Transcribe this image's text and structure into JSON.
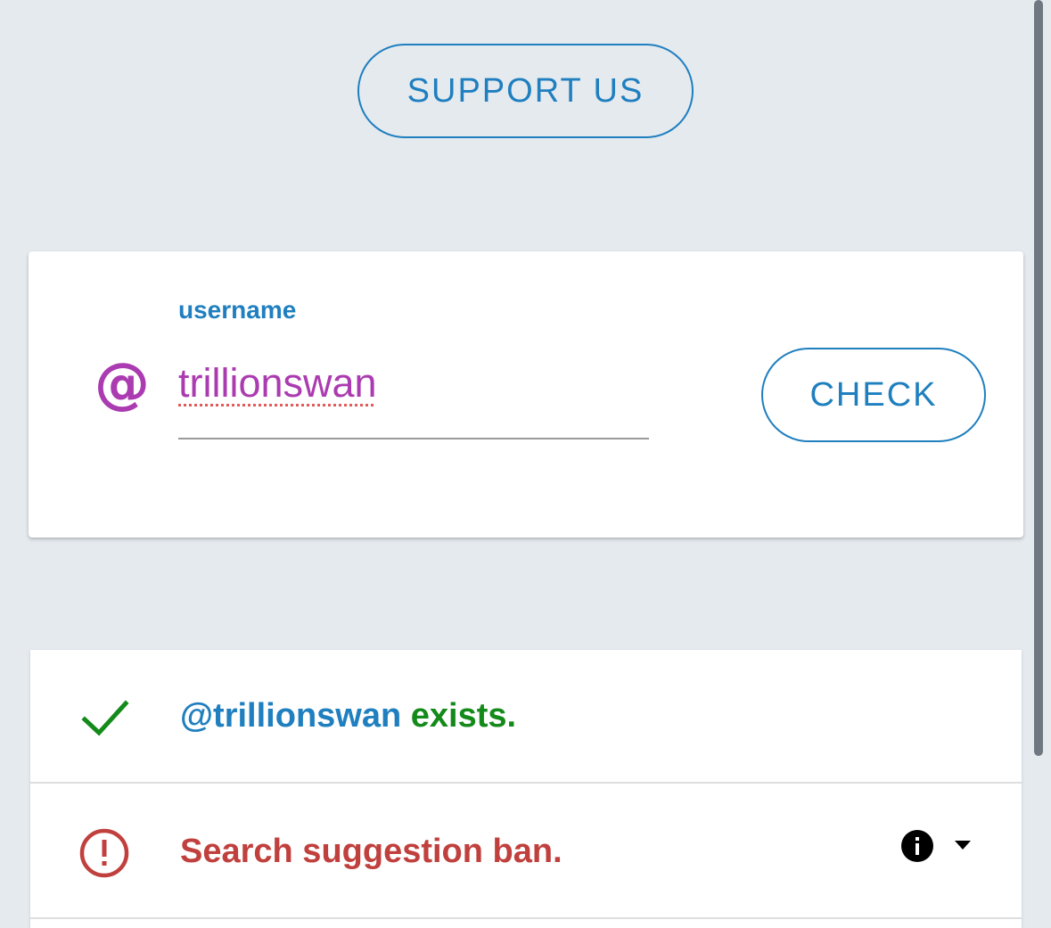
{
  "support": {
    "label": "SUPPORT US"
  },
  "form": {
    "field_label": "username",
    "prefix_symbol": "@",
    "username_value": "trillionswan",
    "check_label": "CHECK"
  },
  "results": [
    {
      "status": "ok",
      "icon": "check-icon",
      "handle": "@trillionswan",
      "message": " exists."
    },
    {
      "status": "error",
      "icon": "alert-circle-icon",
      "message": "Search suggestion ban."
    }
  ],
  "colors": {
    "accent": "#1f7fbf",
    "username": "#ab3bb1",
    "success": "#138a1a",
    "error": "#c0403d",
    "background": "#e5eaef"
  }
}
